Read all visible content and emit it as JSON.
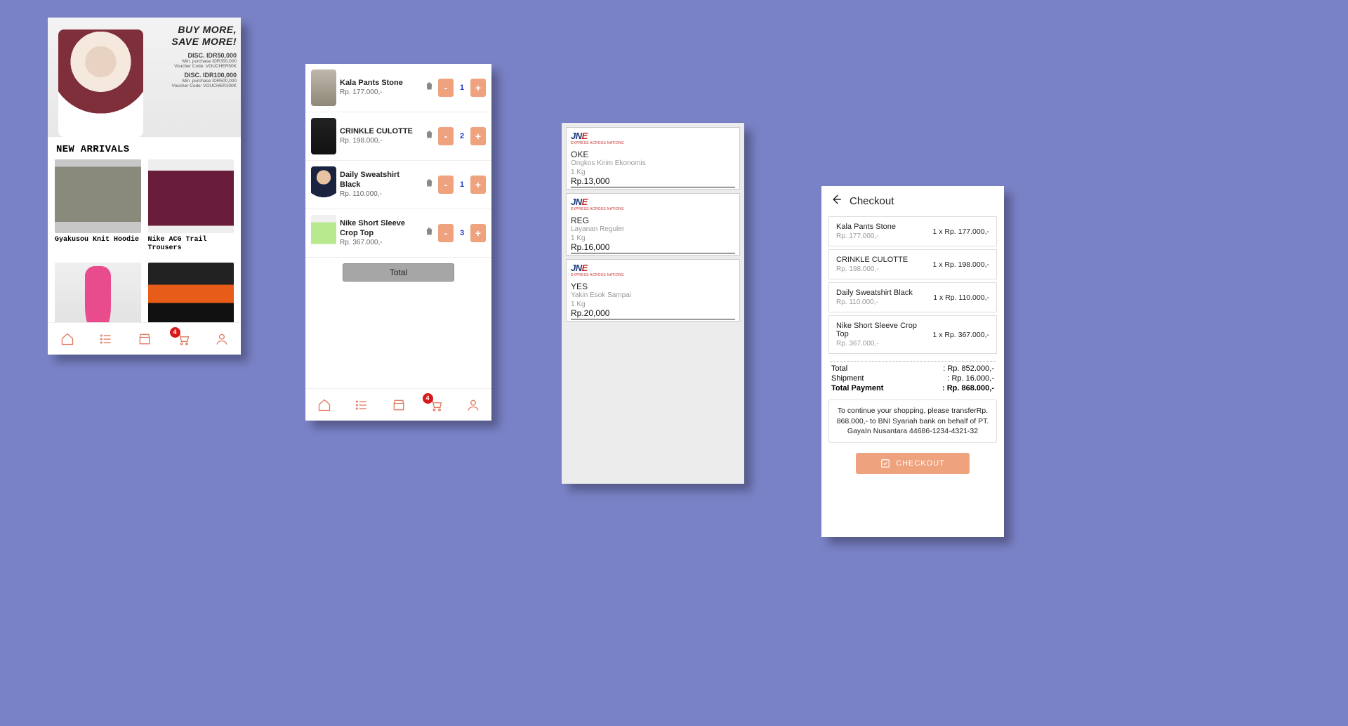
{
  "home": {
    "hero": {
      "title_line1": "BUY MORE,",
      "title_line2": "SAVE MORE!",
      "discounts": [
        {
          "amount": "DISC. IDR50,000",
          "min": "Min. purchase IDR350,000",
          "code": "Voucher Code: VOUCHER50K"
        },
        {
          "amount": "DISC. IDR100,000",
          "min": "Min. purchase IDR500,000",
          "code": "Voucher Code: VOUCHER100K"
        }
      ]
    },
    "section_title": "NEW ARRIVALS",
    "products": [
      {
        "name": "Gyakusou Knit Hoodie"
      },
      {
        "name": "Nike ACG Trail Trousers"
      },
      {
        "name": ""
      },
      {
        "name": ""
      }
    ],
    "tab_badge": "4"
  },
  "cart": {
    "items": [
      {
        "name": "Kala Pants Stone",
        "price": "Rp. 177.000,-",
        "qty": "1"
      },
      {
        "name": "CRINKLE CULOTTE",
        "price": "Rp. 198.000,-",
        "qty": "2"
      },
      {
        "name": " Daily Sweatshirt Black",
        "price": "Rp. 110.000,-",
        "qty": "1"
      },
      {
        "name": "Nike Short Sleeve Crop Top",
        "price": "Rp. 367.000,-",
        "qty": "3"
      }
    ],
    "total_label": "Total",
    "tab_badge": "4"
  },
  "shipping": {
    "carrier_tagline": "EXPRESS ACROSS NATIONS",
    "options": [
      {
        "name": "OKE",
        "desc": "Ongkos Kirim Ekonomis",
        "weight": "1 Kg",
        "price": "Rp.13,000"
      },
      {
        "name": "REG",
        "desc": "Layanan Reguler",
        "weight": "1 Kg",
        "price": "Rp.16,000"
      },
      {
        "name": "YES",
        "desc": "Yakin Esok Sampai",
        "weight": "1 Kg",
        "price": "Rp.20,000"
      }
    ]
  },
  "checkout": {
    "title": "Checkout",
    "items": [
      {
        "name": "Kala Pants Stone",
        "price": "Rp. 177.000,-",
        "line": "1 x Rp. 177.000,-"
      },
      {
        "name": "CRINKLE CULOTTE",
        "price": "Rp. 198.000,-",
        "line": "1 x Rp. 198.000,-"
      },
      {
        "name": " Daily Sweatshirt Black",
        "price": "Rp. 110.000,-",
        "line": "1 x Rp. 110.000,-"
      },
      {
        "name": "Nike Short Sleeve Crop Top",
        "price": "Rp. 367.000,-",
        "line": "1 x Rp. 367.000,-"
      }
    ],
    "summary": {
      "total_label": "Total",
      "total_value": ": Rp. 852.000,-",
      "ship_label": "Shipment",
      "ship_value": ": Rp. 16.000,-",
      "pay_label": "Total Payment",
      "pay_value": ": Rp. 868.000,-"
    },
    "note": "To continue your shopping, please transferRp. 868.000,- to BNI Syariah bank on behalf of PT. GayaIn Nusantara 44686-1234-4321-32",
    "button": "CHECKOUT"
  }
}
